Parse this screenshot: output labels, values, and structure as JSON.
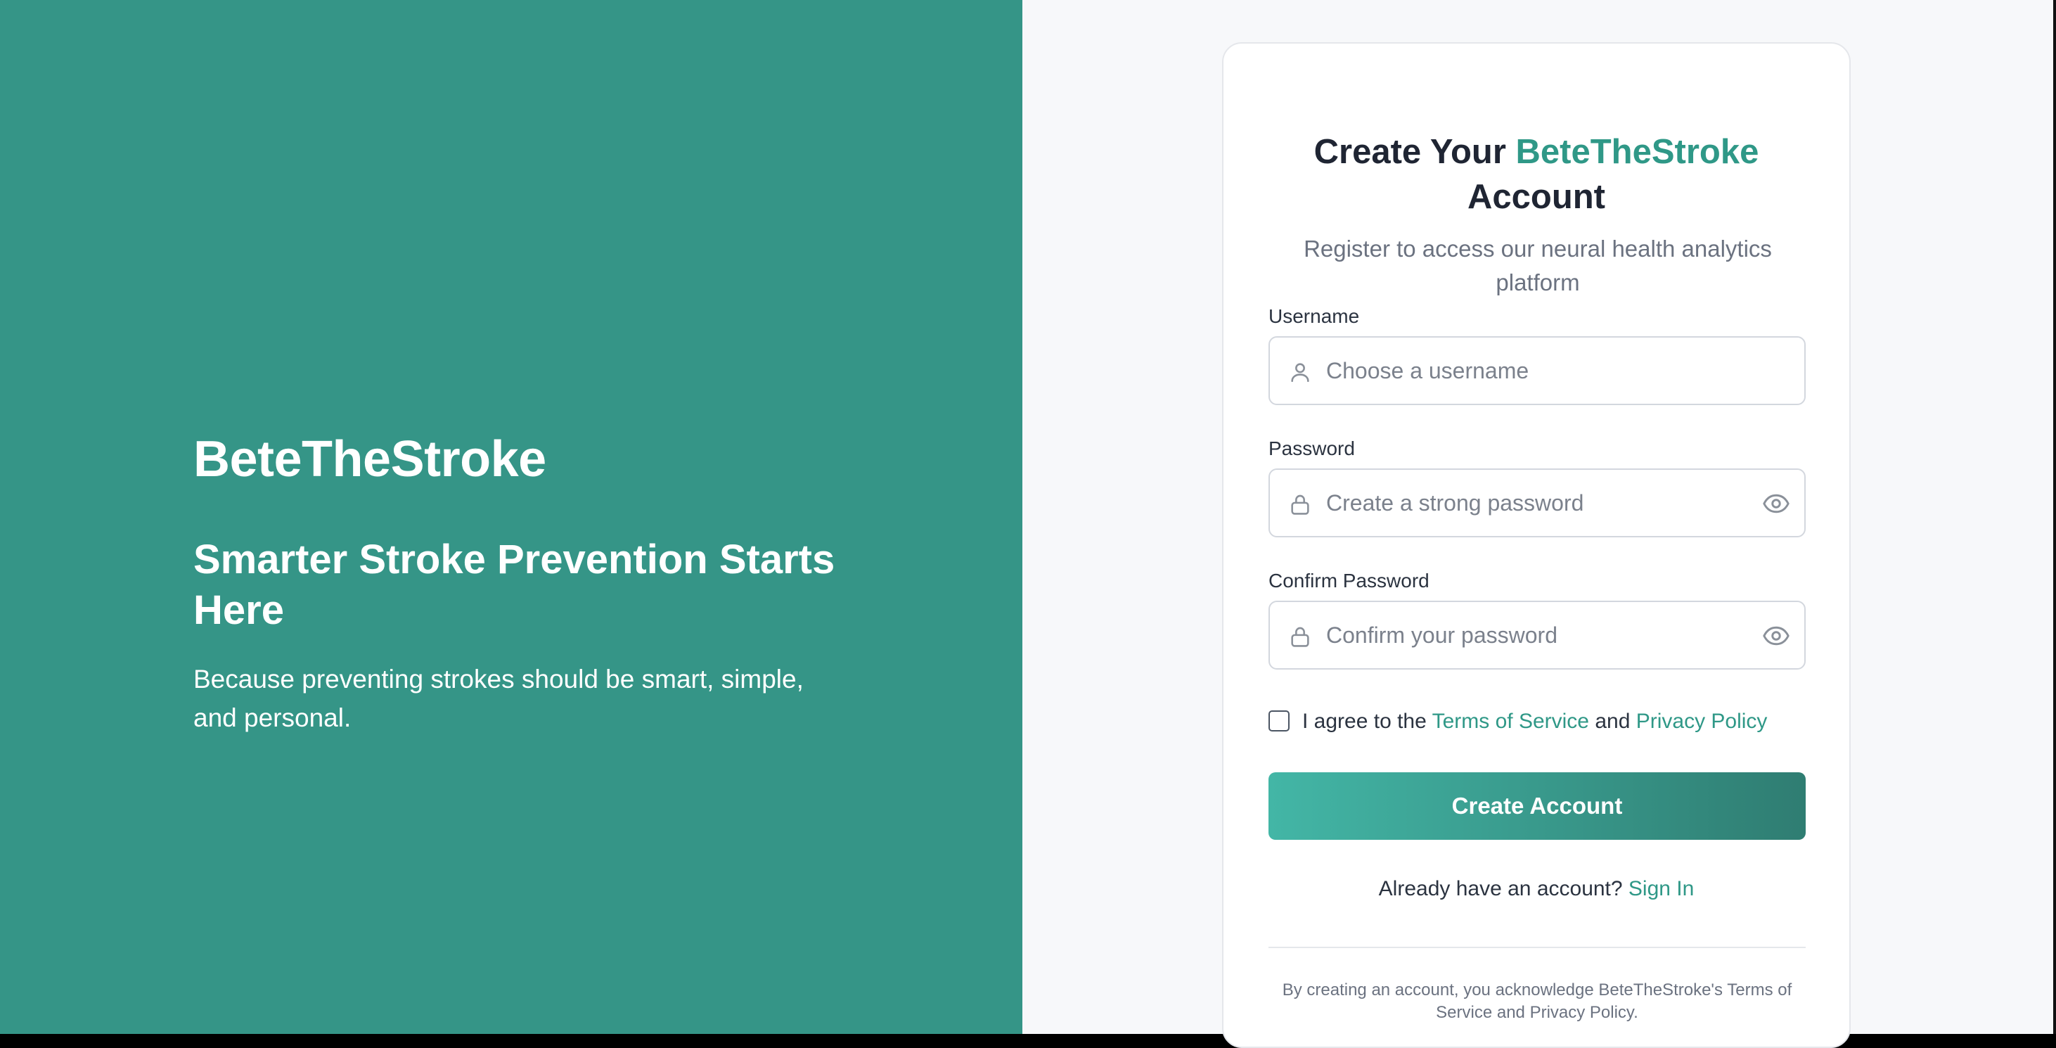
{
  "hero": {
    "brand": "BeteTheStroke",
    "tagline": "Smarter Stroke Prevention Starts Here",
    "subtitle": "Because preventing strokes should be smart, simple, and personal."
  },
  "form": {
    "title_prefix": "Create Your ",
    "title_brand": "BeteTheStroke",
    "title_suffix": " Account",
    "intro": "Register to access our neural health analytics platform",
    "username_label": "Username",
    "username_placeholder": "Choose a username",
    "password_label": "Password",
    "password_placeholder": "Create a strong password",
    "confirm_label": "Confirm Password",
    "confirm_placeholder": "Confirm your password",
    "agree_prefix": "I agree to the ",
    "terms_link": "Terms of Service",
    "agree_and": " and ",
    "privacy_link": "Privacy Policy",
    "agree_checked": false,
    "submit_label": "Create Account",
    "signin_prompt": "Already have an account? ",
    "signin_link": "Sign In",
    "legal": "By creating an account, you acknowledge BeteTheStroke's Terms of Service and Privacy Policy."
  },
  "icons": {
    "username": "user-icon",
    "password": "lock-icon",
    "confirm": "lock-icon",
    "toggle": "eye-icon"
  },
  "colors": {
    "hero_bg": "#359587",
    "accent": "#2f9887",
    "button_start": "#43b6a6",
    "button_end": "#2f7d72"
  }
}
